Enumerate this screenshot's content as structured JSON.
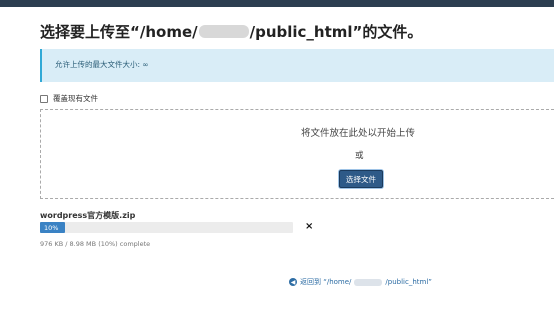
{
  "header": {
    "title_prefix": "选择要上传至“/home/",
    "title_suffix": "/public_html”的文件。"
  },
  "info_banner": {
    "text": "允许上传的最大文件大小: ∞"
  },
  "overwrite": {
    "label": "覆盖现有文件",
    "checked": false
  },
  "dropzone": {
    "hint": "将文件放在此处以开始上传",
    "or_text": "或",
    "select_button": "选择文件"
  },
  "upload": {
    "filename": "wordpress官方模版.zip",
    "progress_label": "10%",
    "progress_percent": 10,
    "close_symbol": "×",
    "status": "976 KB / 8.98 MB (10%) complete"
  },
  "back_link": {
    "prefix": "返回到 “/home/",
    "suffix": "/public_html”"
  },
  "colors": {
    "accent": "#3a82c4",
    "info_bg": "#d9edf7",
    "button_bg": "#2e5a88",
    "link": "#2e6da4"
  }
}
